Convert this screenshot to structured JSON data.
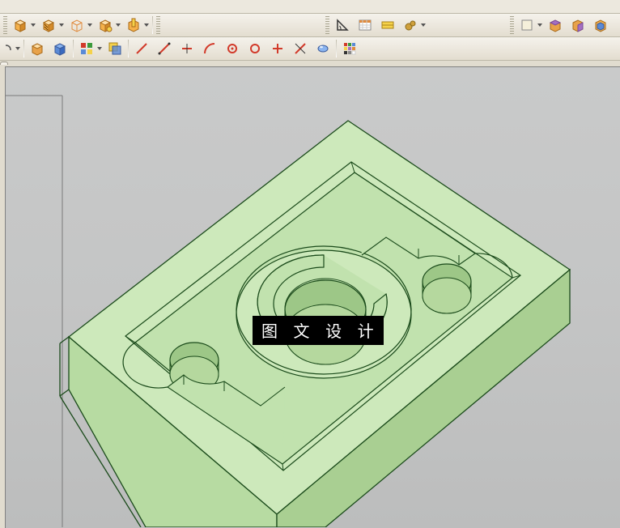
{
  "toolbar_rows": [
    {
      "groups": [
        {
          "items": [
            "menu-partial-1",
            "menu-partial-2",
            "menu-partial-3"
          ]
        }
      ]
    },
    {
      "groups": [
        {
          "items": [
            "new-cube",
            "open-cube",
            "hatch-cube",
            "wireframe-cube",
            "edge-cube",
            "selected-cube",
            "section-cube"
          ]
        },
        {
          "items": [
            "book"
          ]
        },
        {
          "items": [
            "angle",
            "table",
            "dimension",
            "clearance"
          ]
        },
        {
          "items": [
            "sheet",
            "wrap",
            "unwrap",
            "shell"
          ]
        }
      ]
    },
    {
      "groups": [
        {
          "items": [
            "dropdown-arrow"
          ]
        },
        {
          "items": [
            "extrude",
            "box"
          ]
        },
        {
          "items": [
            "palette",
            "intersect"
          ]
        },
        {
          "items": [
            "line",
            "line-angle",
            "trim",
            "arc",
            "circle",
            "ellipse",
            "axis",
            "intersect-line"
          ]
        },
        {
          "items": [
            "material"
          ]
        },
        {
          "items": [
            "swatches"
          ]
        }
      ]
    }
  ],
  "overlay_text": "图 文 设 计",
  "icon_colors": {
    "cube_face": "#f5b14a",
    "cube_side": "#d48b2a",
    "cube_top": "#ffe0a8",
    "book": "#6a7fb0",
    "angle": "#333",
    "table_head": "#e08a3c",
    "dim_yellow": "#f5d24a",
    "gear": "#cfa03c",
    "blue": "#5a8ad6",
    "rect": "#f5f0da",
    "wrap_purple": "#a46fc2",
    "wrap_orange": "#e89a3c",
    "ext_blue": "#5a8ad6",
    "ext_orange": "#e8a24a",
    "red": "#d23a2a",
    "green": "#3c9a3c"
  },
  "model": {
    "name": "machined-block",
    "color": "#c8e8b8"
  }
}
